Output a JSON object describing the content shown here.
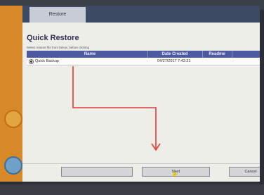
{
  "window": {
    "tab_label": "Restore"
  },
  "dialog": {
    "title": "Quick Restore",
    "subtitle": "Select restore file from below, before clicking"
  },
  "table": {
    "headers": [
      "Name",
      "Date Created",
      "Readme",
      ""
    ],
    "rows": [
      {
        "name": "Quick Backup",
        "date": "04/27/2017 7:42:21",
        "readme": "",
        "extra": ""
      }
    ]
  },
  "footer": {
    "back_label": "",
    "next_label": "Next",
    "cancel_label": "Cancel"
  },
  "colors": {
    "annotation_arrow": "#e33a3a",
    "cursor": "#e8c500"
  }
}
